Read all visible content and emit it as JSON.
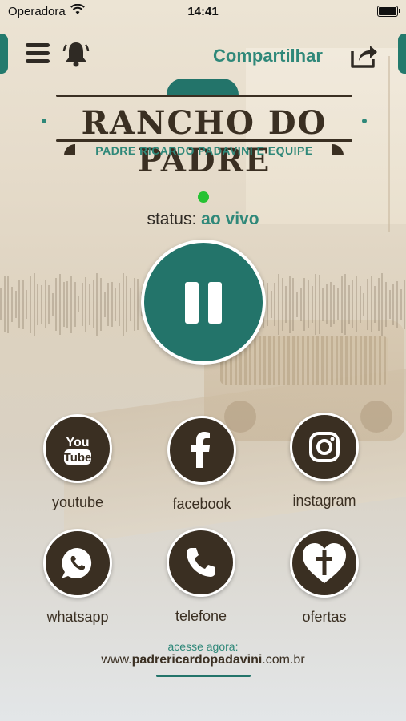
{
  "statusbar": {
    "carrier": "Operadora",
    "time": "14:41"
  },
  "header": {
    "share_label": "Compartilhar"
  },
  "logo": {
    "title": "RANCHO DO PADRE",
    "subtitle": "PADRE RICARDO PADAVINI E EQUIPE"
  },
  "player": {
    "status_label": "status:",
    "status_value": "ao vivo"
  },
  "social": [
    {
      "label": "youtube",
      "icon": "youtube-icon"
    },
    {
      "label": "facebook",
      "icon": "facebook-icon"
    },
    {
      "label": "instagram",
      "icon": "instagram-icon"
    },
    {
      "label": "whatsapp",
      "icon": "whatsapp-icon"
    },
    {
      "label": "telefone",
      "icon": "phone-icon"
    },
    {
      "label": "ofertas",
      "icon": "heart-cross-icon"
    }
  ],
  "footer": {
    "access_label": "acesse agora:",
    "site_prefix": "www.",
    "site_bold": "padrericardopadavini",
    "site_suffix": ".com.br"
  },
  "colors": {
    "teal": "#23746a",
    "accent": "#2f8879",
    "brown": "#3a2f22",
    "live": "#26c233"
  }
}
